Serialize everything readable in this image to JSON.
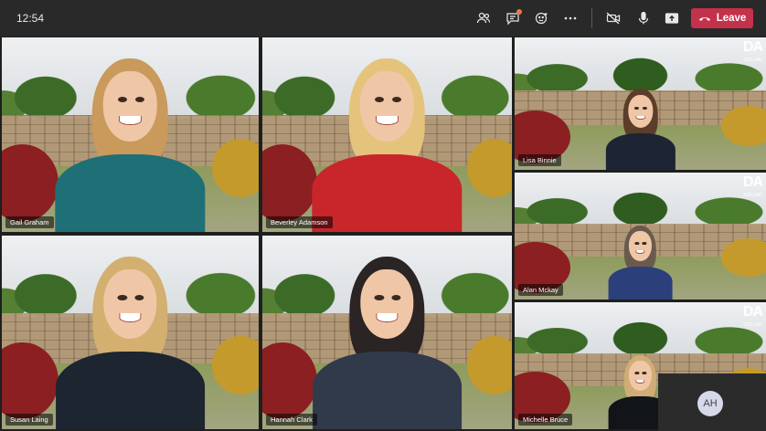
{
  "topbar": {
    "time": "12:54",
    "leave_label": "Leave",
    "icons": [
      "participants-icon",
      "chat-icon",
      "reactions-icon",
      "more-icon",
      "camera-off-icon",
      "microphone-icon",
      "share-icon",
      "phone-hangup-icon"
    ]
  },
  "participants": [
    {
      "name": "Gail Graham",
      "hair": "#c99a5c",
      "top": "#1f6f76"
    },
    {
      "name": "Beverley Adamson",
      "hair": "#e4c47c",
      "top": "#c8262a"
    },
    {
      "name": "Lisa Binnie",
      "hair": "#5b3d2a",
      "top": "#1d2433"
    },
    {
      "name": "Alan Mckay",
      "hair": "#6a5a4e",
      "top": "#2b3f7a"
    },
    {
      "name": "Susan Laing",
      "hair": "#d3b070",
      "top": "#1c2530"
    },
    {
      "name": "Hannah Clark",
      "hair": "#2a2424",
      "top": "#313a4b"
    },
    {
      "name": "Michelle Bruce",
      "hair": "#d0ad76",
      "top": "#111418"
    }
  ],
  "brand": {
    "logo_text": "DA",
    "sub_text": "DOLLAR"
  },
  "self": {
    "initials": "AH"
  }
}
